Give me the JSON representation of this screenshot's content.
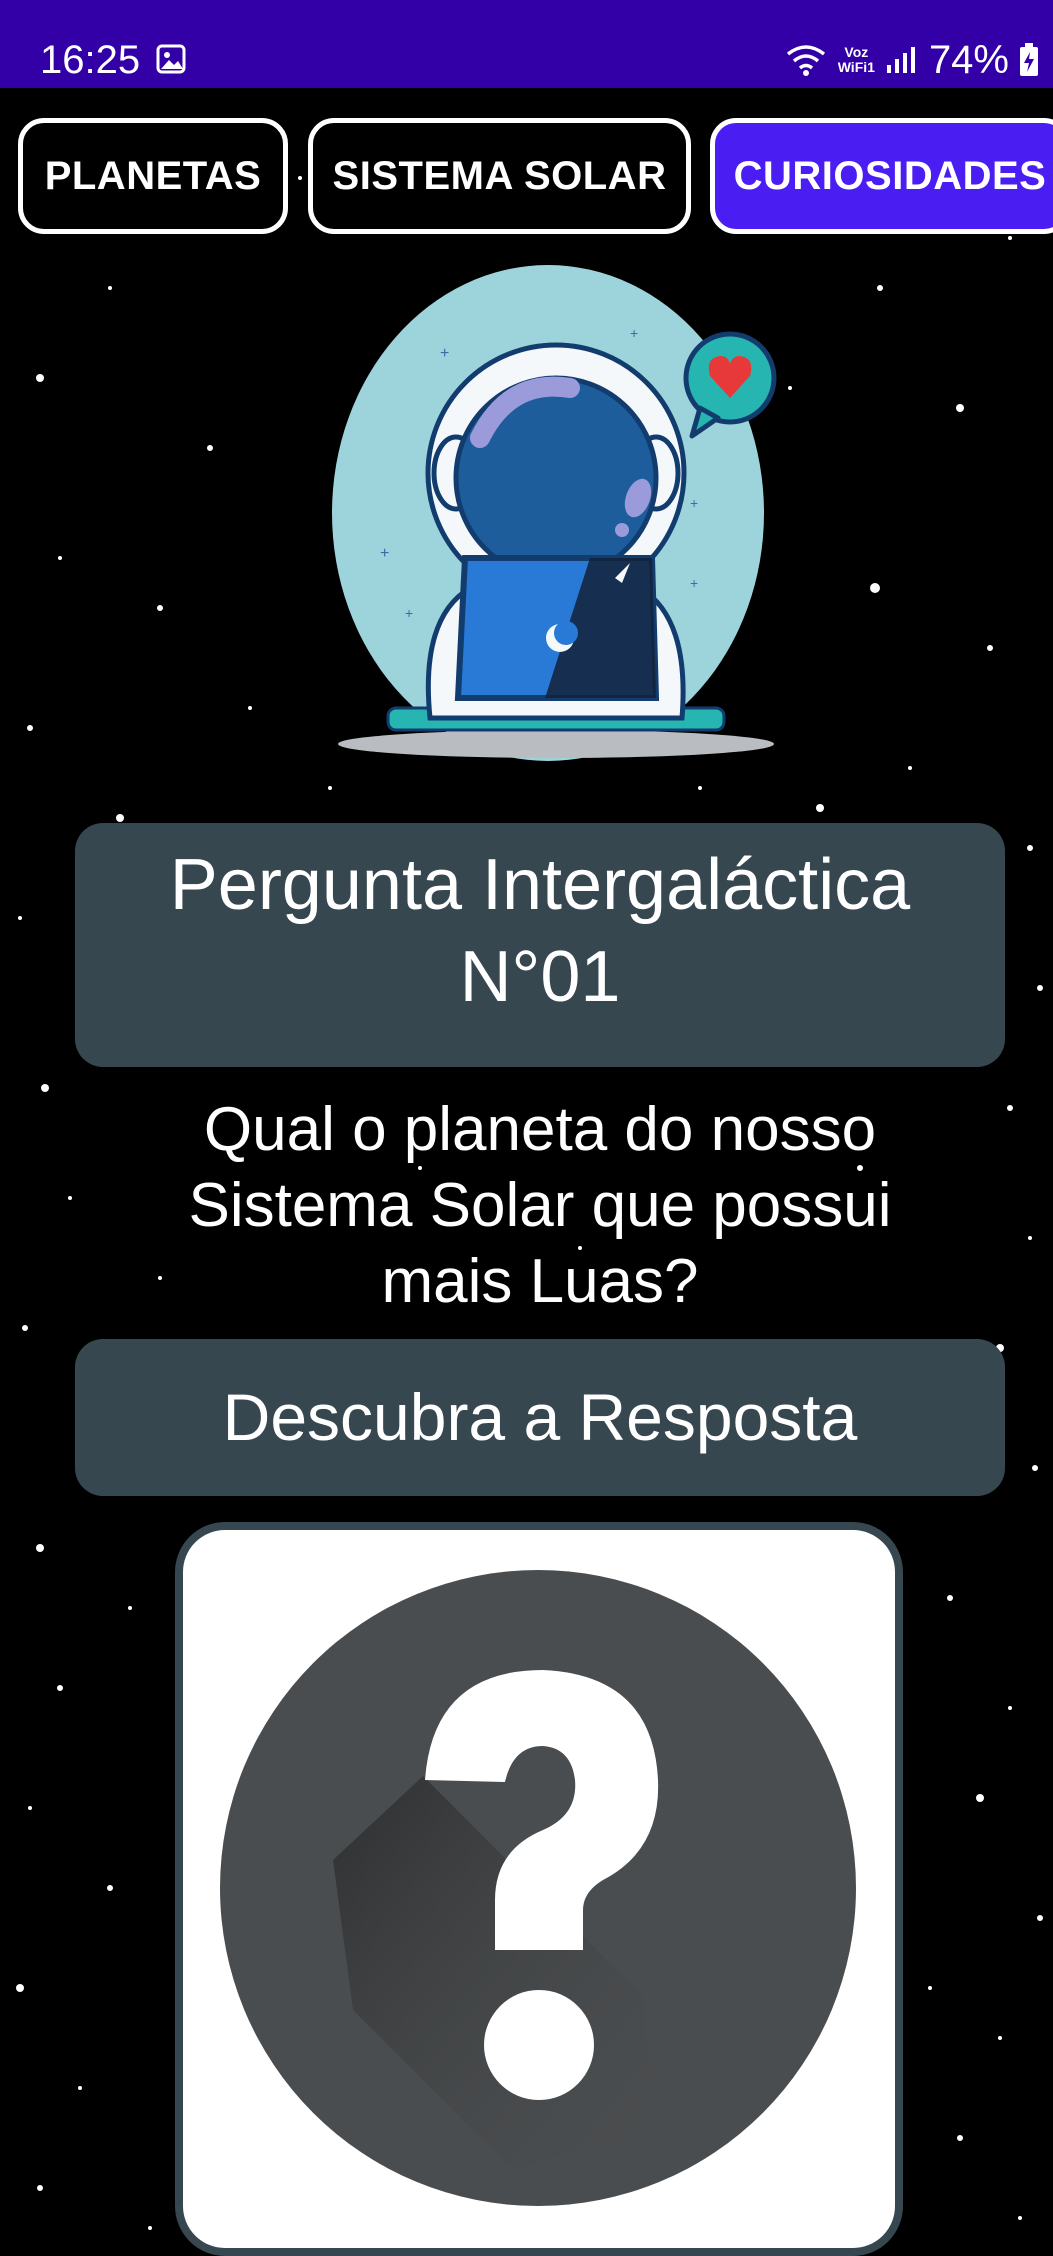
{
  "status_bar": {
    "time": "16:25",
    "voz_line1": "Voz",
    "voz_line2": "WiFi1",
    "battery": "74%"
  },
  "tabs": [
    {
      "label": "PLANETAS",
      "active": false
    },
    {
      "label": "SISTEMA SOLAR",
      "active": false
    },
    {
      "label": "CURIOSIDADES",
      "active": true
    }
  ],
  "card": {
    "title_line1": "Pergunta Intergaláctica",
    "title_line2": "N°01"
  },
  "question": {
    "line1": "Qual o planeta do nosso",
    "line2": "Sistema Solar que possui",
    "line3": "mais Luas?"
  },
  "reveal_button": "Descubra a Resposta",
  "icons": {
    "hero": "astronaut-laptop-illustration",
    "answer": "question-mark-icon"
  },
  "colors": {
    "status_bar": "#3300a8",
    "active_tab": "#4a1df2",
    "card": "#37474f",
    "background": "#000000"
  }
}
